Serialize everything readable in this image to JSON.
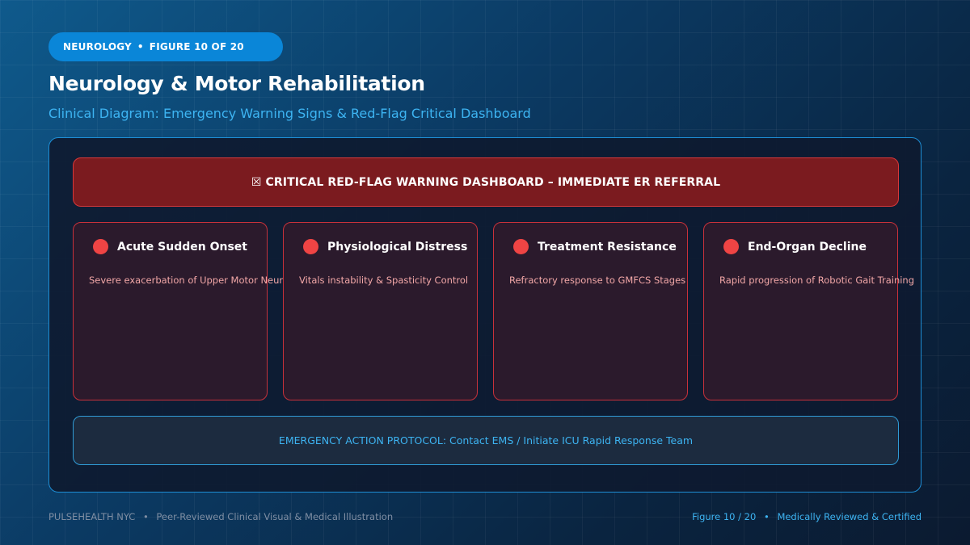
{
  "header": {
    "category": "NEUROLOGY",
    "separator": "•",
    "figure_label": "FIGURE 10 OF 20",
    "title": "Neurology & Motor Rehabilitation",
    "subtitle": "Clinical Diagram: Emergency Warning Signs & Red-Flag Critical Dashboard"
  },
  "dashboard": {
    "banner": "☒ CRITICAL RED-FLAG WARNING DASHBOARD – IMMEDIATE ER REFERRAL",
    "cards": [
      {
        "title": "Acute Sudden Onset",
        "description": "Severe exacerbation of Upper Motor Neurons"
      },
      {
        "title": "Physiological Distress",
        "description": "Vitals instability & Spasticity Control"
      },
      {
        "title": "Treatment Resistance",
        "description": "Refractory response to GMFCS Stages"
      },
      {
        "title": "End-Organ Decline",
        "description": "Rapid progression of Robotic Gait Training"
      }
    ],
    "protocol": "EMERGENCY ACTION PROTOCOL: Contact EMS / Initiate ICU Rapid Response Team"
  },
  "footer": {
    "brand": "PULSEHEALTH NYC",
    "separator": "•",
    "tagline": "Peer-Reviewed Clinical Visual & Medical Illustration",
    "figure": "Figure 10 / 20",
    "certification": "Medically Reviewed & Certified"
  },
  "colors": {
    "accent_blue": "#3db4f2",
    "alert_red": "#ef4444",
    "banner_red": "#7b1b1f"
  }
}
